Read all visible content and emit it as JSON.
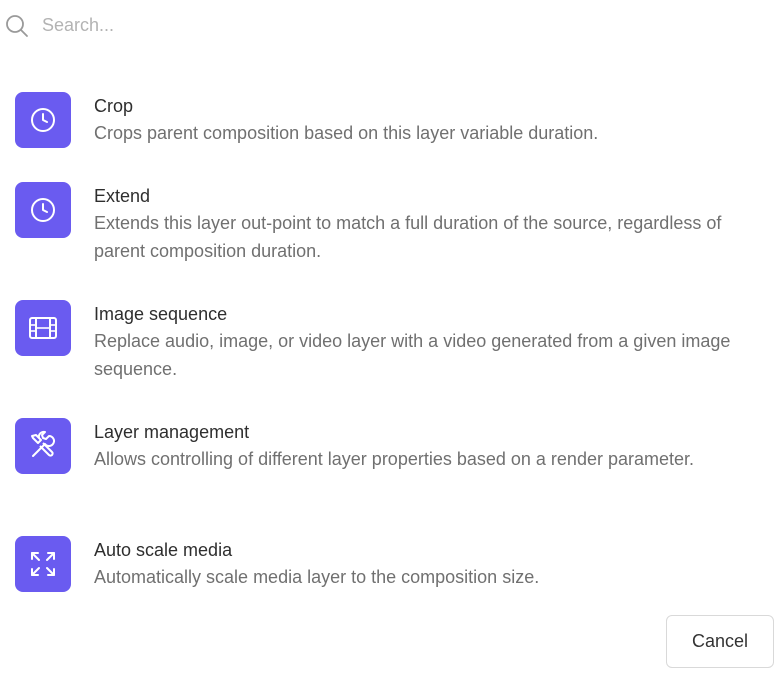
{
  "search": {
    "placeholder": "Search...",
    "value": "",
    "icon": "search-icon"
  },
  "items": [
    {
      "title": "Crop",
      "description": "Crops parent composition based on this layer variable duration.",
      "icon": "clock-icon"
    },
    {
      "title": "Extend",
      "description": "Extends this layer out-point to match a full duration of the source, regardless of parent composition duration.",
      "icon": "clock-icon"
    },
    {
      "title": "Image sequence",
      "description": "Replace audio, image, or video layer with a video generated from a given image sequence.",
      "icon": "film-icon"
    },
    {
      "title": "Layer management",
      "description": "Allows controlling of different layer properties based on a render parameter.",
      "icon": "tools-icon"
    },
    {
      "title": "Auto scale media",
      "description": "Automatically scale media layer to the composition size.",
      "icon": "scale-arrows-icon"
    }
  ],
  "footer": {
    "cancel_label": "Cancel"
  },
  "colors": {
    "accent": "#6a5bf0",
    "title_text": "#2e2e2e",
    "description_text": "#707070",
    "placeholder_text": "#b3b3b3"
  }
}
